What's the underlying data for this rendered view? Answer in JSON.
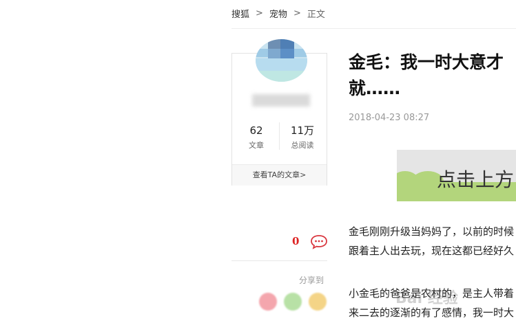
{
  "breadcrumb": {
    "home": "搜狐",
    "sep": ">",
    "section": "宠物",
    "current": "正文"
  },
  "author": {
    "stats": [
      {
        "value": "62",
        "label": "文章"
      },
      {
        "value": "11万",
        "label": "总阅读"
      }
    ],
    "link": "查看TA的文章>"
  },
  "actions": {
    "comment_count": "0",
    "share_label": "分享到"
  },
  "article": {
    "title_line1": "金毛：我一时大意才",
    "title_line2": "就……",
    "date": "2018-04-23 08:27",
    "banner_text": "点击上方",
    "paragraph1_line1": "金毛刚刚升级当妈妈了，以前的时候",
    "paragraph1_line2": "跟着主人出去玩，现在这都已经好久",
    "paragraph2_line1": "小金毛的爸爸是农村的，是主人带着",
    "paragraph2_line2": "来二去的逐渐的有了感情，我一时大",
    "watermark": "Bai 经验"
  }
}
